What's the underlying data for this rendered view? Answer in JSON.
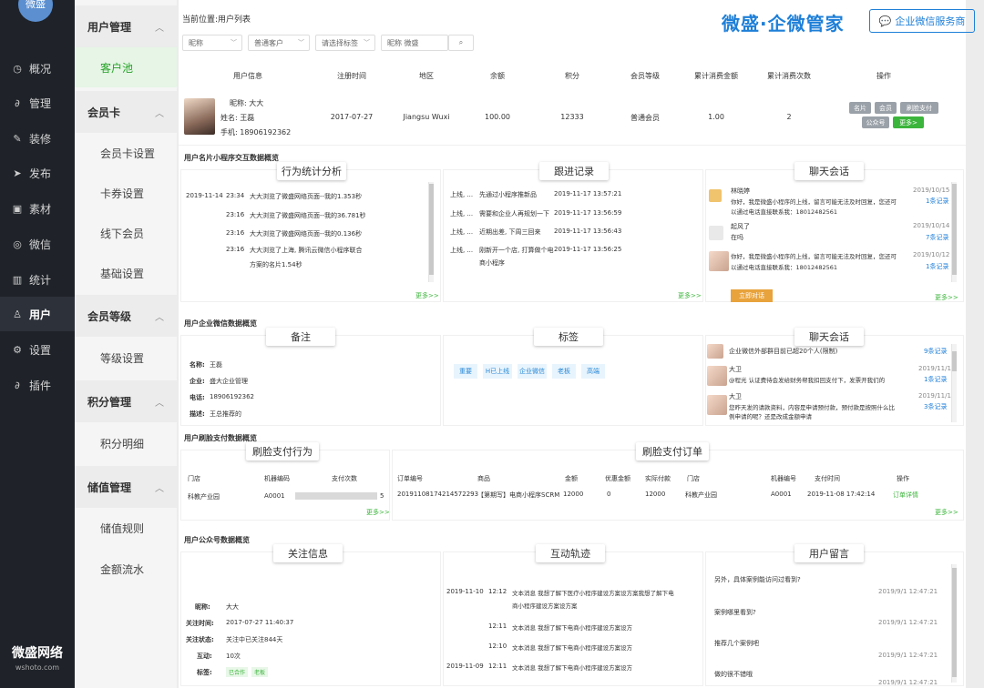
{
  "nav": {
    "logo": "微盛",
    "items": [
      {
        "label": "概况",
        "icon": "clock-icon"
      },
      {
        "label": "管理",
        "icon": "link-icon"
      },
      {
        "label": "装修",
        "icon": "brush-icon"
      },
      {
        "label": "发布",
        "icon": "send-icon"
      },
      {
        "label": "素材",
        "icon": "image-icon"
      },
      {
        "label": "微信",
        "icon": "wechat-icon"
      },
      {
        "label": "统计",
        "icon": "chart-icon"
      },
      {
        "label": "用户",
        "icon": "user-icon"
      },
      {
        "label": "设置",
        "icon": "gear-icon"
      },
      {
        "label": "插件",
        "icon": "plugin-icon"
      }
    ],
    "active": "用户",
    "brand": "微盛网络",
    "brand_sub": "wshoto.com"
  },
  "sub": {
    "groups": [
      {
        "label": "用户管理",
        "links": [
          "客户池"
        ]
      },
      {
        "label": "会员卡",
        "links": [
          "会员卡设置",
          "卡券设置",
          "线下会员",
          "基础设置"
        ]
      },
      {
        "label": "会员等级",
        "links": [
          "等级设置"
        ]
      },
      {
        "label": "积分管理",
        "links": [
          "积分明细"
        ]
      },
      {
        "label": "储值管理",
        "links": [
          "储值规则",
          "金额流水"
        ]
      }
    ],
    "active": "客户池"
  },
  "header": {
    "breadcrumb": "当前位置:用户列表",
    "brand_title": "微盛·企微管家",
    "service_button": "企业微信服务商"
  },
  "filters": {
    "f1": "昵称",
    "f2": "普通客户",
    "f3": "请选择标签",
    "search": "昵称 微盛"
  },
  "table": {
    "headers": [
      "用户信息",
      "注册时间",
      "地区",
      "余额",
      "积分",
      "会员等级",
      "累计消费金额",
      "累计消费次数",
      "操作"
    ],
    "row": {
      "nick": "昵称: 大大",
      "name": "姓名: 王磊",
      "phone": "手机: 18906192362",
      "reg": "2017-07-27",
      "region": "Jiangsu Wuxi",
      "balance": "100.00",
      "points": "12333",
      "level": "普通会员",
      "spend": "1.00",
      "count": "2",
      "ops": [
        "名片",
        "会员",
        "刷脸支付",
        "公众号",
        "更多>"
      ]
    }
  },
  "sec1": {
    "title": "用户名片小程序交互数据概览",
    "tabs": [
      "行为统计分析",
      "跟进记录",
      "聊天会话"
    ],
    "behavior": [
      {
        "date": "2019-11-14",
        "time": "23:34",
        "text": "大大浏览了微盛网络页面--我的1.353秒"
      },
      {
        "date": "",
        "time": "23:16",
        "text": "大大浏览了微盛网络页面--我的36.781秒"
      },
      {
        "date": "",
        "time": "23:16",
        "text": "大大浏览了微盛网络页面--我的0.136秒"
      },
      {
        "date": "",
        "time": "23:16",
        "text": "大大浏览了上海, 腾讯云微信小程序联合"
      },
      {
        "date": "",
        "time": "",
        "text": "方案的名片1.54秒"
      }
    ],
    "follow": [
      {
        "who": "上线, ...",
        "text": "先通过小程序推新品",
        "time": "2019-11-17 13:57:21"
      },
      {
        "who": "上线, ...",
        "text": "需要和企业人再规划一下",
        "time": "2019-11-17 13:56:59"
      },
      {
        "who": "上线, ...",
        "text": "近期出差, 下周三回来",
        "time": "2019-11-17 13:56:43"
      },
      {
        "who": "上线, ...",
        "text": "刚新开一个店, 打算做个电",
        "time": "2019-11-17 13:56:25"
      },
      {
        "who": "",
        "text": "商小程序",
        "time": ""
      }
    ],
    "chat": [
      {
        "name": "林晓婷",
        "line1": "你好，我是微盛小程序的上线，留言可能无法及时回复，您还可",
        "line2": "以通过电话直接联系我：18012482561",
        "date": "2019/10/15",
        "link": "1条记录"
      },
      {
        "name": "起风了",
        "line1": "在吗",
        "line2": "",
        "date": "2019/10/14",
        "link": "7条记录"
      },
      {
        "name": "",
        "line1": "你好，我是微盛小程序的上线，留言可能无法及时回复，您还可",
        "line2": "以通过电话直接联系我：18012482561",
        "date": "2019/10/12",
        "link": "1条记录"
      }
    ],
    "chat_button": "立即对话",
    "more": "更多>>"
  },
  "sec2": {
    "title": "用户企业微信数据概览",
    "tabs": [
      "备注",
      "标签",
      "聊天会话"
    ],
    "remark": [
      {
        "k": "名称:",
        "v": "王磊"
      },
      {
        "k": "企业:",
        "v": "盛大企业管理"
      },
      {
        "k": "电话:",
        "v": "18906192362"
      },
      {
        "k": "描述:",
        "v": "王总推荐的"
      }
    ],
    "tags": [
      "重要",
      "H已上线",
      "企业微信",
      "老板",
      "高端"
    ],
    "chat": [
      {
        "name": "",
        "line1": "企业微信外部群目前已超20个人(限制)",
        "line2": "",
        "date": "",
        "link": "9条记录"
      },
      {
        "name": "大卫",
        "line1": "@程光 认证费待会发给财务帮我扣回支付下，发票开我们的",
        "line2": "",
        "date": "2019/11/1",
        "link": "1条记录"
      },
      {
        "name": "大卫",
        "line1": "您昨天发的请款资料，内容是申请预付款，预付款是按照什么比",
        "line2": "例申请的呢？还是改成金额申请",
        "date": "2019/11/1",
        "link": "3条记录"
      }
    ]
  },
  "sec3": {
    "title": "用户刷脸支付数据概览",
    "tabs": [
      "刷脸支付行为",
      "刷脸支付订单"
    ],
    "behavior_headers": [
      "门店",
      "机器编码",
      "支付次数"
    ],
    "behavior_row": {
      "store": "科教产业园",
      "code": "A0001",
      "count": "5"
    },
    "order_headers": [
      "订单编号",
      "商品",
      "金额",
      "优惠金额",
      "实际付款",
      "门店",
      "机器编号",
      "支付时间",
      "操作"
    ],
    "order_row": {
      "no": "20191108174214572293",
      "goods": "【第期写】电商小程序SCRM",
      "amount": "12000",
      "discount": "0",
      "paid": "12000",
      "store": "科教产业园",
      "code": "A0001",
      "time": "2019-11-08 17:42:14",
      "op": "订单详情"
    },
    "more": "更多>>"
  },
  "sec4": {
    "title": "用户公众号数据概览",
    "tabs": [
      "关注信息",
      "互动轨迹",
      "用户留言"
    ],
    "follow": [
      {
        "k": "昵称:",
        "v": "大大"
      },
      {
        "k": "关注时间:",
        "v": "2017-07-27 11:40:37"
      },
      {
        "k": "关注状态:",
        "v": "关注中已关注844天"
      },
      {
        "k": "互动:",
        "v": "10次"
      },
      {
        "k": "标签:",
        "v": ""
      }
    ],
    "follow_tags": [
      "已合作",
      "老板"
    ],
    "track": [
      {
        "date": "2019-11-10",
        "time": "12:12",
        "text": "文本消息 我想了解下医疗小程序建设方案设方案我想了解下电"
      },
      {
        "date": "",
        "time": "",
        "text": "商小程序建设方案设方案"
      },
      {
        "date": "",
        "time": "12:11",
        "text": "文本消息 我想了解下电商小程序建设方案设方"
      },
      {
        "date": "",
        "time": "12:10",
        "text": "文本消息 我想了解下电商小程序建设方案设方"
      },
      {
        "date": "2019-11-09",
        "time": "12:11",
        "text": "文本消息 我想了解下电商小程序建设方案设方"
      }
    ],
    "messages": [
      {
        "text": "另外，具体案例能访问过看到?",
        "time": "2019/9/1 12:47:21"
      },
      {
        "text": "案例哪里看到?",
        "time": "2019/9/1 12:47:21"
      },
      {
        "text": "推荐几个案例吧",
        "time": "2019/9/1 12:47:21"
      },
      {
        "text": "做的很不错哦",
        "time": "2019/9/1 12:47:21"
      }
    ]
  },
  "colors": {
    "accent": "#3cb53c",
    "brand": "#1e7fd8",
    "nav": "#1f2329"
  }
}
